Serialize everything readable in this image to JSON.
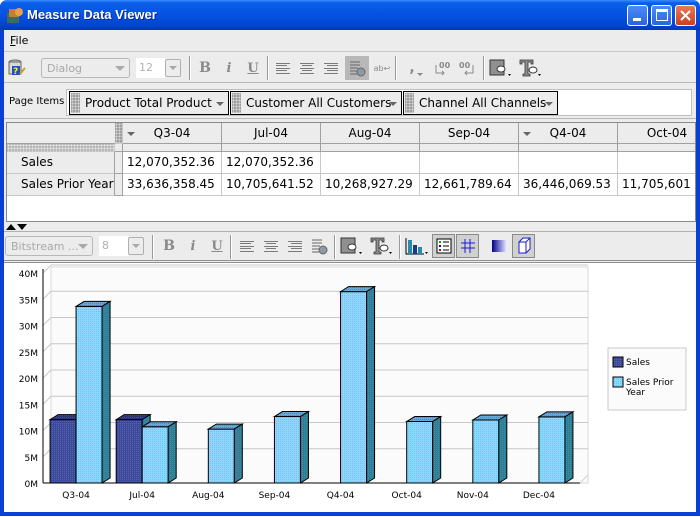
{
  "window": {
    "title": "Measure Data Viewer",
    "controls": [
      "minimize",
      "maximize",
      "close"
    ]
  },
  "menubar": {
    "items": [
      {
        "label": "File",
        "mnemonic": "F"
      }
    ]
  },
  "table_toolbar": {
    "font_family": "Dialog",
    "font_size": "12",
    "buttons": [
      "help-icon",
      "bold",
      "italic",
      "underline",
      "align-left",
      "align-center",
      "align-right",
      "cell-format",
      "wrap-text",
      "thousands-separator",
      "increase-decimal",
      "decrease-decimal",
      "fill-color",
      "text-color"
    ],
    "bold_glyph": "B",
    "italic_glyph": "i",
    "underline_glyph": "U",
    "comma_glyph": ",",
    "wrap_glyph": "ab↩"
  },
  "page_items": {
    "label": "Page Items",
    "items": [
      {
        "dimension": "Product",
        "value": "Total Product",
        "text": "Product  Total Product"
      },
      {
        "dimension": "Customer",
        "value": "All Customers",
        "text": "Customer  All Customers"
      },
      {
        "dimension": "Channel",
        "value": "All Channels",
        "text": "Channel  All Channels"
      }
    ]
  },
  "grid": {
    "columns": [
      "Q3-04",
      "Jul-04",
      "Aug-04",
      "Sep-04",
      "Q4-04",
      "Oct-04"
    ],
    "rows": [
      {
        "label": "Sales",
        "values": [
          "12,070,352.36",
          "12,070,352.36",
          "",
          "",
          "",
          ""
        ]
      },
      {
        "label": "Sales Prior Year",
        "values": [
          "33,636,358.45",
          "10,705,641.52",
          "10,268,927.29",
          "12,661,789.64",
          "36,446,069.53",
          "11,705,601"
        ]
      }
    ]
  },
  "graph_toolbar": {
    "font_family": "Bitstream ...",
    "font_size": "8",
    "bold_glyph": "B",
    "italic_glyph": "i",
    "underline_glyph": "U",
    "buttons": [
      "bold",
      "italic",
      "underline",
      "align-left",
      "align-center",
      "align-right",
      "format",
      "fill-color",
      "text-color",
      "graph-type",
      "legend-toggle",
      "gridlines-toggle",
      "gradient",
      "3d-effect"
    ]
  },
  "colors": {
    "sales": "#3c4a9a",
    "sales_prior_year": "#8fd6ff",
    "bar_side": "#2e7f96",
    "title_bar": "#0453e0",
    "scroll_thumb": "#d4d8ff"
  },
  "chart_data": {
    "type": "bar",
    "style": "3d-clustered",
    "title": "",
    "xlabel": "",
    "ylabel": "",
    "categories": [
      "Q3-04",
      "Jul-04",
      "Aug-04",
      "Sep-04",
      "Q4-04",
      "Oct-04",
      "Nov-04",
      "Dec-04"
    ],
    "series": [
      {
        "name": "Sales",
        "values": [
          12.07,
          12.07,
          null,
          null,
          null,
          null,
          null,
          null
        ]
      },
      {
        "name": "Sales Prior Year",
        "values": [
          33.64,
          10.71,
          10.27,
          12.66,
          36.45,
          11.71,
          12.0,
          12.6
        ]
      }
    ],
    "yunit": "M",
    "ylim": [
      0,
      40
    ],
    "yticks": [
      "0M",
      "5M",
      "10M",
      "15M",
      "20M",
      "25M",
      "30M",
      "35M",
      "40M"
    ],
    "grid": true,
    "legend": {
      "position": "right",
      "entries": [
        "Sales",
        "Sales Prior Year"
      ]
    }
  }
}
